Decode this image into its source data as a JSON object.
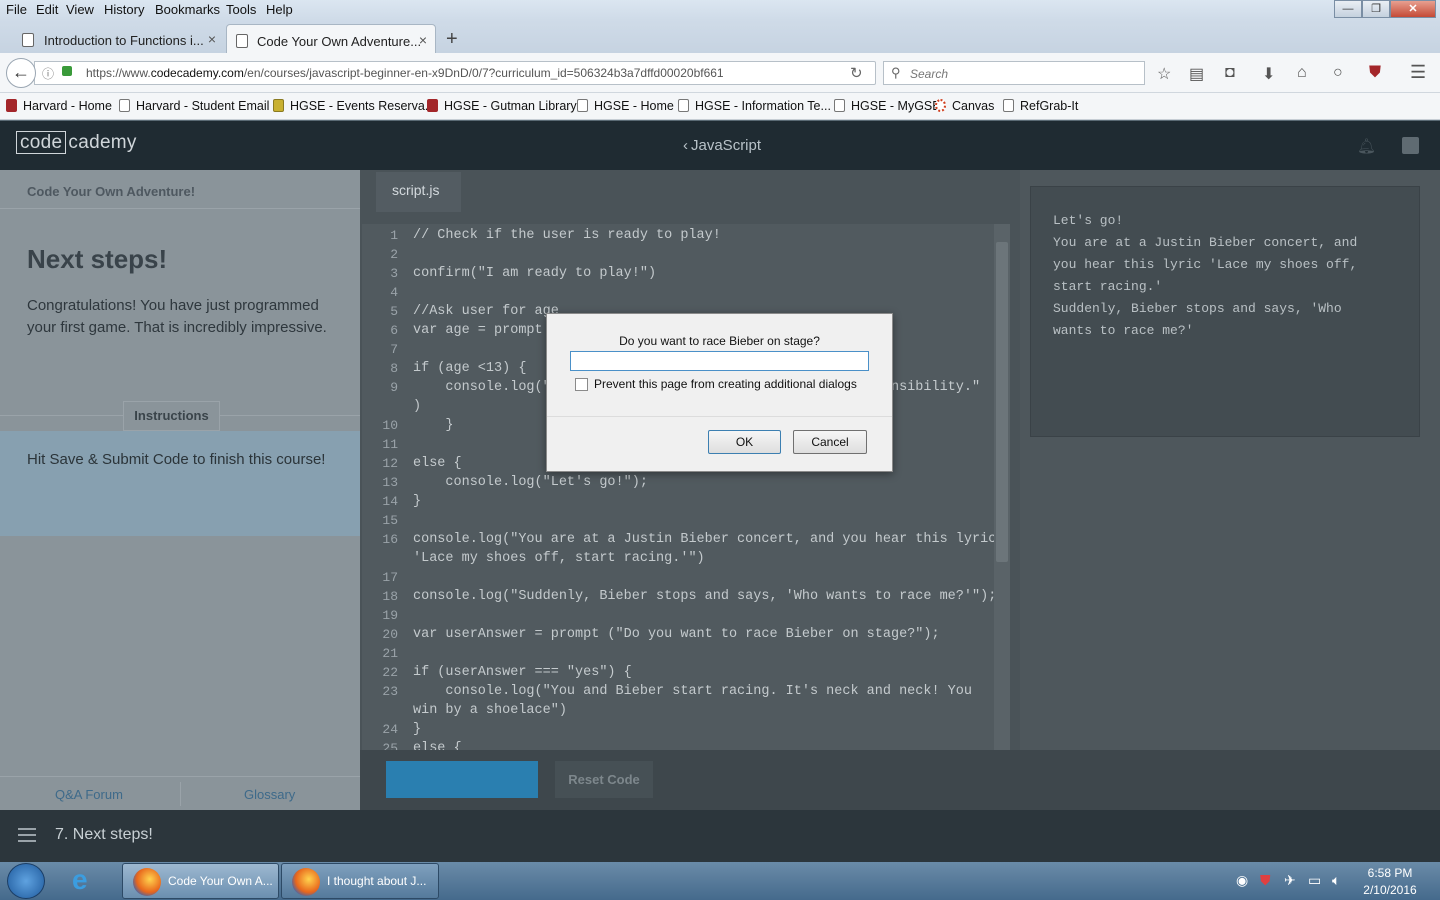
{
  "menu": [
    "File",
    "Edit",
    "View",
    "History",
    "Bookmarks",
    "Tools",
    "Help"
  ],
  "window_buttons": {
    "minimize": "—",
    "maximize": "❐",
    "close": "✕"
  },
  "tabs": [
    {
      "label": "Introduction to Functions i...",
      "active": false
    },
    {
      "label": "Code Your Own Adventure...",
      "active": true
    }
  ],
  "newtab": "+",
  "nav": {
    "back": "←",
    "url_prefix": "https://www.",
    "url_domain": "codecademy.com",
    "url_rest": "/en/courses/javascript-beginner-en-x9DnD/0/7?curriculum_id=506324b3a7dffd00020bf661",
    "reload": "↻",
    "search_placeholder": "Search"
  },
  "bookmarks": [
    "Harvard - Home",
    "Harvard - Student Email",
    "HGSE - Events Reserva...",
    "HGSE - Gutman Library",
    "HGSE - Home",
    "HGSE - Information Te...",
    "HGSE - MyGSE",
    "Canvas",
    "RefGrab-It"
  ],
  "cc": {
    "logo_a": "code",
    "logo_b": "cademy",
    "course": "JavaScript",
    "course_prefix": "‹"
  },
  "lesson": {
    "course_title": "Code Your Own Adventure!",
    "title": "Next steps!",
    "body": "Congratulations! You have just programmed your first game. That is incredibly impressive.",
    "instructions_label": "Instructions",
    "instructions": "Hit Save & Submit Code to finish this course!",
    "qa": "Q&A Forum",
    "glossary": "Glossary"
  },
  "editor": {
    "file": "script.js",
    "lines": [
      {
        "n": "1",
        "t": "// Check if the user is ready to play!"
      },
      {
        "n": "2",
        "t": ""
      },
      {
        "n": "3",
        "t": "confirm(\"I am ready to play!\")"
      },
      {
        "n": "4",
        "t": ""
      },
      {
        "n": "5",
        "t": "//Ask user for age"
      },
      {
        "n": "6",
        "t": "var age = prompt"
      },
      {
        "n": "7",
        "t": ""
      },
      {
        "n": "8",
        "t": "if (age <13) {"
      },
      {
        "n": "9",
        "t": "    console.log(\"                                         onsibility.\""
      },
      {
        "n": "",
        "t": ")"
      },
      {
        "n": "10",
        "t": "    }"
      },
      {
        "n": "11",
        "t": ""
      },
      {
        "n": "12",
        "t": "else {"
      },
      {
        "n": "13",
        "t": "    console.log(\"Let's go!\");"
      },
      {
        "n": "14",
        "t": "}"
      },
      {
        "n": "15",
        "t": ""
      },
      {
        "n": "16",
        "t": "console.log(\"You are at a Justin Bieber concert, and you hear this lyric"
      },
      {
        "n": "",
        "t": "'Lace my shoes off, start racing.'\")"
      },
      {
        "n": "17",
        "t": ""
      },
      {
        "n": "18",
        "t": "console.log(\"Suddenly, Bieber stops and says, 'Who wants to race me?'\");"
      },
      {
        "n": "19",
        "t": ""
      },
      {
        "n": "20",
        "t": "var userAnswer = prompt (\"Do you want to race Bieber on stage?\");"
      },
      {
        "n": "21",
        "t": ""
      },
      {
        "n": "22",
        "t": "if (userAnswer === \"yes\") {"
      },
      {
        "n": "23",
        "t": "    console.log(\"You and Bieber start racing. It's neck and neck! You"
      },
      {
        "n": "",
        "t": "win by a shoelace\")"
      },
      {
        "n": "24",
        "t": "}"
      },
      {
        "n": "25",
        "t": "else {"
      }
    ],
    "reset": "Reset Code"
  },
  "output": [
    "Let's go!",
    "You are at a Justin Bieber concert, and",
    "you hear this lyric 'Lace my shoes off,",
    "start racing.'",
    "Suddenly, Bieber stops and says, 'Who",
    "wants to race me?'"
  ],
  "step": "7. Next steps!",
  "dialog": {
    "message": "Do you want to race Bieber on stage?",
    "input_value": "",
    "checkbox_label": "Prevent this page from creating additional dialogs",
    "ok": "OK",
    "cancel": "Cancel"
  },
  "taskbar": {
    "task1": "Code Your Own A...",
    "task2": "I thought about J...",
    "time": "6:58 PM",
    "date": "2/10/2016"
  }
}
